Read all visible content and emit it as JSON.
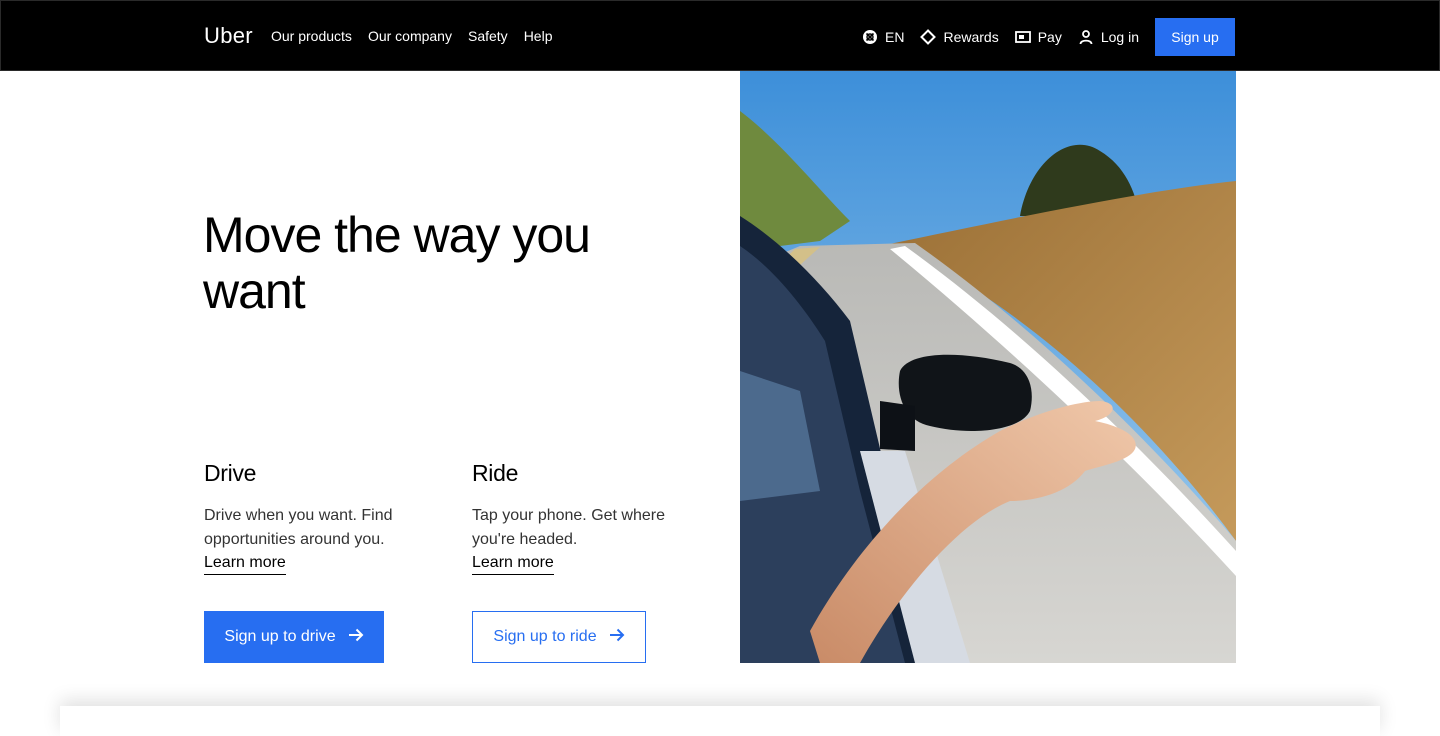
{
  "nav": {
    "logo": "Uber",
    "links": [
      "Our products",
      "Our company",
      "Safety",
      "Help"
    ],
    "language": "EN",
    "rewards": "Rewards",
    "pay": "Pay",
    "login": "Log in",
    "signup": "Sign up"
  },
  "hero": {
    "title": "Move the way you want"
  },
  "drive": {
    "heading": "Drive",
    "description": "Drive when you want. Find opportunities around you.",
    "learn_more": "Learn more",
    "cta": "Sign up to drive"
  },
  "ride": {
    "heading": "Ride",
    "description": "Tap your phone. Get where you're headed.",
    "learn_more": "Learn more",
    "cta": "Sign up to ride"
  },
  "colors": {
    "brand_blue": "#276ef1",
    "nav_bg": "#000000"
  },
  "icons": {
    "language": "globe-icon",
    "rewards": "diamond-icon",
    "pay": "wallet-icon",
    "login": "person-icon",
    "cta_arrow": "arrow-right-icon"
  }
}
